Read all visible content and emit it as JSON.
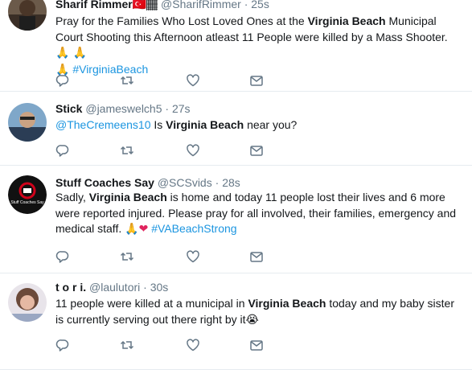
{
  "tweets": [
    {
      "name": "Sharif Rimmer",
      "name_emoji": "🇹🇷🏾",
      "handle": "@SharifRimmer",
      "dot": "·",
      "time": "25s",
      "segments": [
        {
          "t": "Pray for the Families Who Lost Loved Ones at the "
        },
        {
          "t": "Virginia Beach",
          "b": true
        },
        {
          "t": " Municipal Court Shooting this Afternoon atleast 11 People were killed by a Mass Shooter. "
        },
        {
          "t": "🙏 🙏",
          "e": true
        },
        {
          "t": "\n"
        },
        {
          "t": "🙏",
          "e": true
        },
        {
          "t": " "
        },
        {
          "t": "#VirginiaBeach",
          "link": true
        }
      ]
    },
    {
      "name": "Stick",
      "handle": "@jameswelch5",
      "dot": "·",
      "time": "27s",
      "segments": [
        {
          "t": "@TheCremeens10",
          "link": true
        },
        {
          "t": "  Is "
        },
        {
          "t": "Virginia Beach",
          "b": true
        },
        {
          "t": " near you?"
        }
      ]
    },
    {
      "name": "Stuff Coaches Say",
      "handle": "@SCSvids",
      "dot": "·",
      "time": "28s",
      "avatar_text": "Stuff Coaches Say",
      "segments": [
        {
          "t": "Sadly, "
        },
        {
          "t": "Virginia Beach",
          "b": true
        },
        {
          "t": " is home and today 11 people lost their lives and 6 more were reported injured. Please pray for all involved, their families, emergency and medical staff. "
        },
        {
          "t": "🙏",
          "e": true
        },
        {
          "t": "❤",
          "e": true,
          "red": true
        },
        {
          "t": " "
        },
        {
          "t": "#VABeachStrong",
          "link": true
        }
      ]
    },
    {
      "name": "t o r i.",
      "handle": "@laulutori",
      "dot": "·",
      "time": "30s",
      "segments": [
        {
          "t": "11 people were killed at a municipal in "
        },
        {
          "t": "Virginia Beach",
          "b": true
        },
        {
          "t": " today and my baby sister is currently serving out there right by it"
        },
        {
          "t": "😭",
          "e": true
        }
      ]
    }
  ],
  "actions": {
    "reply": "reply-icon",
    "retweet": "retweet-icon",
    "like": "heart-icon",
    "message": "envelope-icon"
  },
  "colors": {
    "link": "#1b95e0",
    "muted": "#657786",
    "divider": "#e6ecf0"
  }
}
